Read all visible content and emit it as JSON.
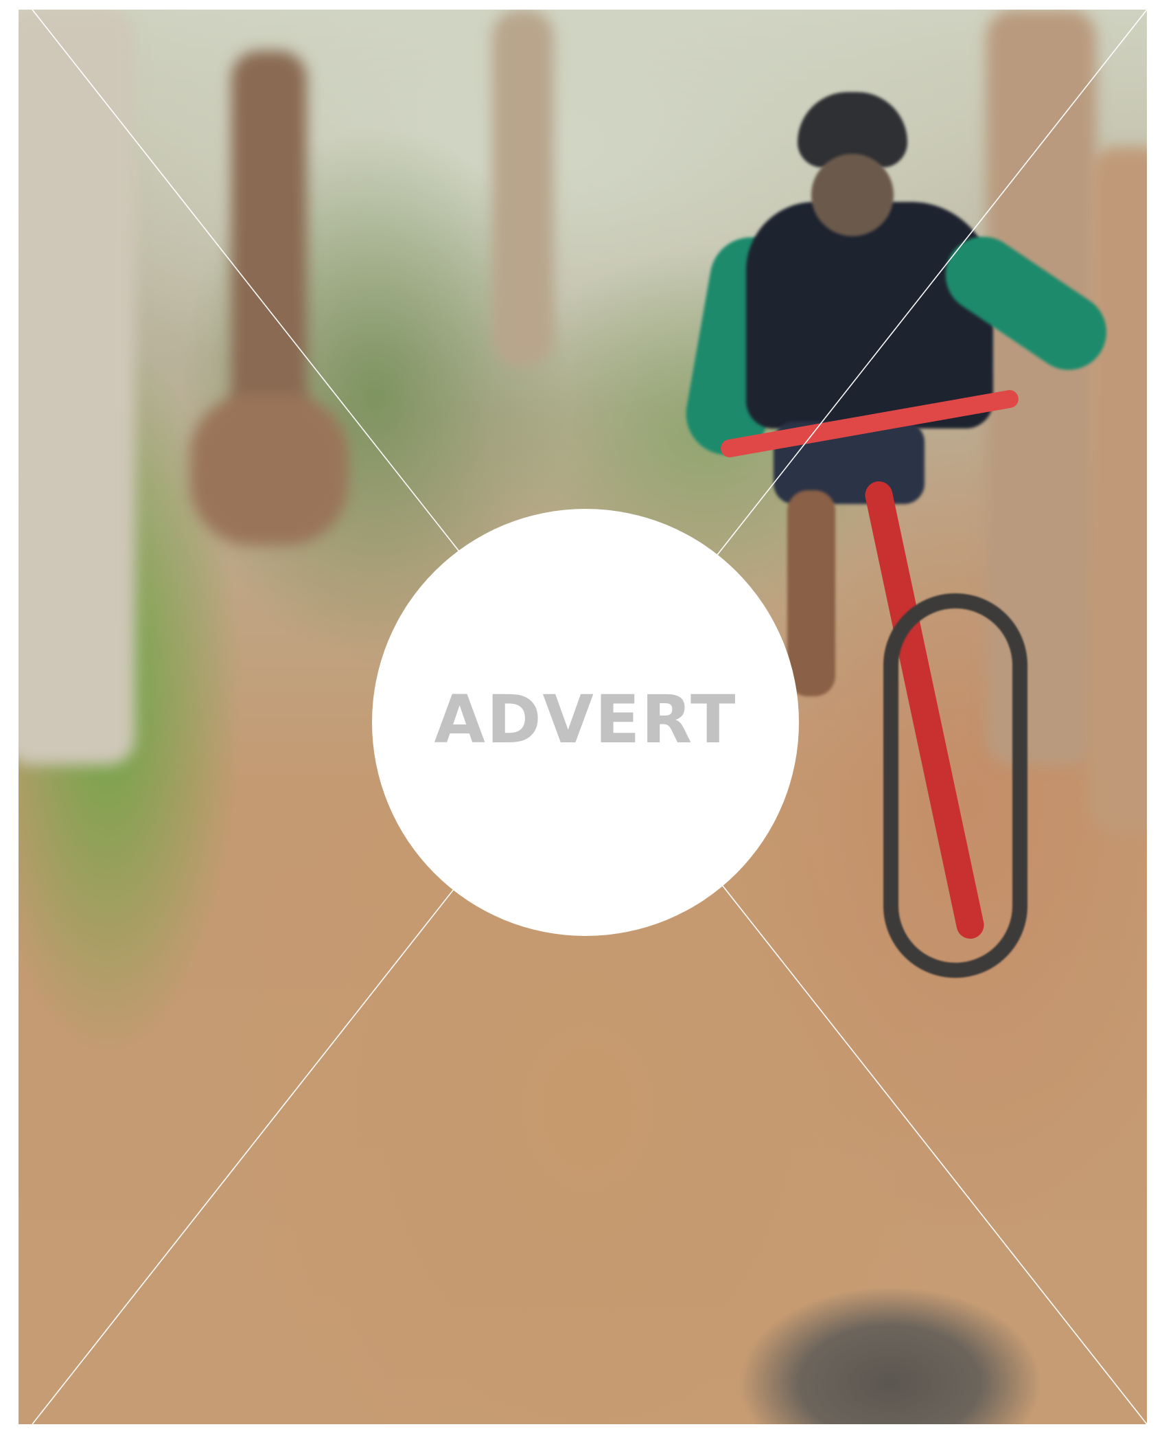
{
  "advert": {
    "label": "ADVERT",
    "label_color": "#c2c2c2",
    "circle_color": "#ffffff",
    "line_color": "#ffffff"
  },
  "photo": {
    "subject": "mountain-biker-on-forest-trail"
  }
}
